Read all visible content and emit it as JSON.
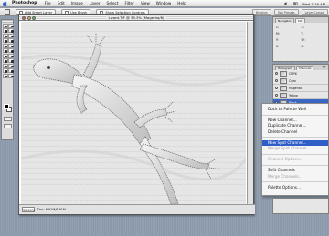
{
  "menubar": {
    "app_name": "Photoshop",
    "items": [
      "File",
      "Edit",
      "Image",
      "Layer",
      "Select",
      "Filter",
      "View",
      "Window",
      "Help"
    ],
    "clock": "Wed 3:16 AM"
  },
  "options_bar": {
    "btn_a": "Add Smart Layer",
    "btn_b": "Use Brush",
    "btn_c": "Show Selection Controls"
  },
  "well": {
    "tabs": [
      "Brushes",
      "Tool Presets",
      "Layer Comps"
    ]
  },
  "document": {
    "title": "Lizard.TIF @ 33.3% (Magenta/8)",
    "zoom": "33.33%",
    "status": "Doc: 6.91M/6.91M"
  },
  "info_palette": {
    "tabs": [
      "Navigator",
      "Info"
    ],
    "labels": [
      "C:",
      "M:",
      "Y:",
      "K:",
      "X:",
      "Y:",
      "W:",
      "H:"
    ]
  },
  "channels_palette": {
    "tabs": [
      "Histogram",
      "Channels"
    ],
    "rows": [
      {
        "name": "CMYK",
        "selected": false
      },
      {
        "name": "Cyan",
        "selected": false
      },
      {
        "name": "Magenta",
        "selected": false
      },
      {
        "name": "Yellow",
        "selected": false
      },
      {
        "name": "Black",
        "selected": true
      }
    ]
  },
  "channel_menu": {
    "items": [
      {
        "label": "Dock to Palette Well",
        "state": "normal"
      },
      {
        "sep": true
      },
      {
        "label": "New Channel...",
        "state": "normal"
      },
      {
        "label": "Duplicate Channel...",
        "state": "normal"
      },
      {
        "label": "Delete Channel",
        "state": "normal"
      },
      {
        "sep": true
      },
      {
        "label": "New Spot Channel...",
        "state": "highlight"
      },
      {
        "label": "Merge Spot Channel",
        "state": "disabled"
      },
      {
        "sep": true
      },
      {
        "label": "Channel Options...",
        "state": "disabled"
      },
      {
        "sep": true
      },
      {
        "label": "Split Channels",
        "state": "normal"
      },
      {
        "label": "Merge Channels...",
        "state": "disabled"
      },
      {
        "sep": true
      },
      {
        "label": "Palette Options...",
        "state": "normal"
      }
    ]
  }
}
